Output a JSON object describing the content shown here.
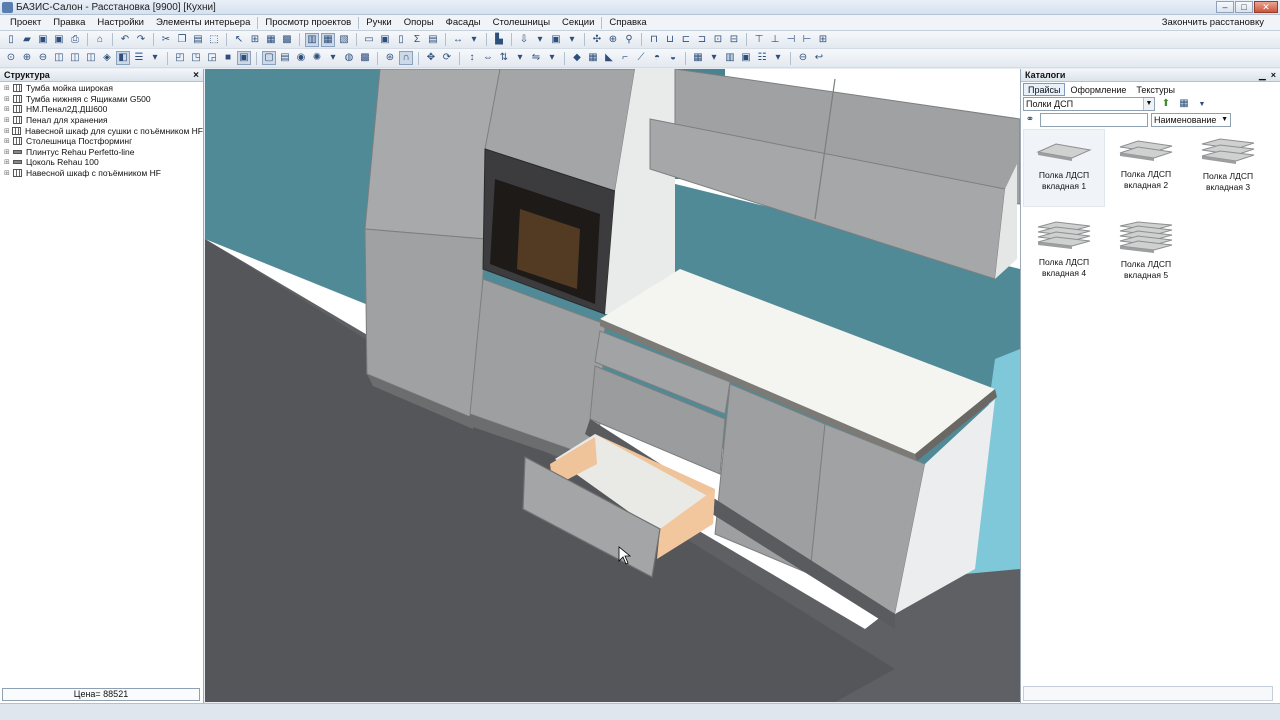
{
  "window": {
    "title": "БАЗИС-Салон -  Расстановка [9900] [Кухни]"
  },
  "menu": {
    "items": [
      "Проект",
      "Правка",
      "Настройки",
      "Элементы интерьера",
      "Просмотр проектов",
      "Ручки",
      "Опоры",
      "Фасады",
      "Столешницы",
      "Секции",
      "Справка"
    ],
    "finish": "Закончить расстановку"
  },
  "structure_panel": {
    "title": "Структура",
    "items": [
      "Тумба мойка широкая",
      "Тумба нижняя с Ящиками G500",
      "НМ.Пенал2Д.ДШ600",
      "Пенал для хранения",
      "Навесной шкаф для сушки с поъёмником HF",
      "Столешница Постформинг",
      "Плинтус Rehau Perfetto-line",
      "Цоколь Rehau 100",
      "Навесной шкаф с поъёмником HF"
    ],
    "price": "Цена= 88521"
  },
  "catalog_panel": {
    "title": "Каталоги",
    "tabs": [
      "Прайсы",
      "Оформление",
      "Текстуры"
    ],
    "active_tab": "Прайсы",
    "category": "Полки ДСП",
    "search_value": "",
    "sort_by": "Наименование",
    "items": [
      {
        "line1": "Полка ЛДСП",
        "line2": "вкладная 1"
      },
      {
        "line1": "Полка ЛДСП",
        "line2": "вкладная 2"
      },
      {
        "line1": "Полка ЛДСП",
        "line2": "вкладная 3"
      },
      {
        "line1": "Полка ЛДСП",
        "line2": "вкладная 4"
      },
      {
        "line1": "Полка ЛДСП",
        "line2": "вкладная 5"
      }
    ]
  },
  "colors": {
    "wall": "#4f8a96",
    "floor": "#5f6063",
    "cabinet": "#9d9fa0",
    "countertop": "#f4f4f1",
    "drawer_inner": "#f0c49a"
  }
}
